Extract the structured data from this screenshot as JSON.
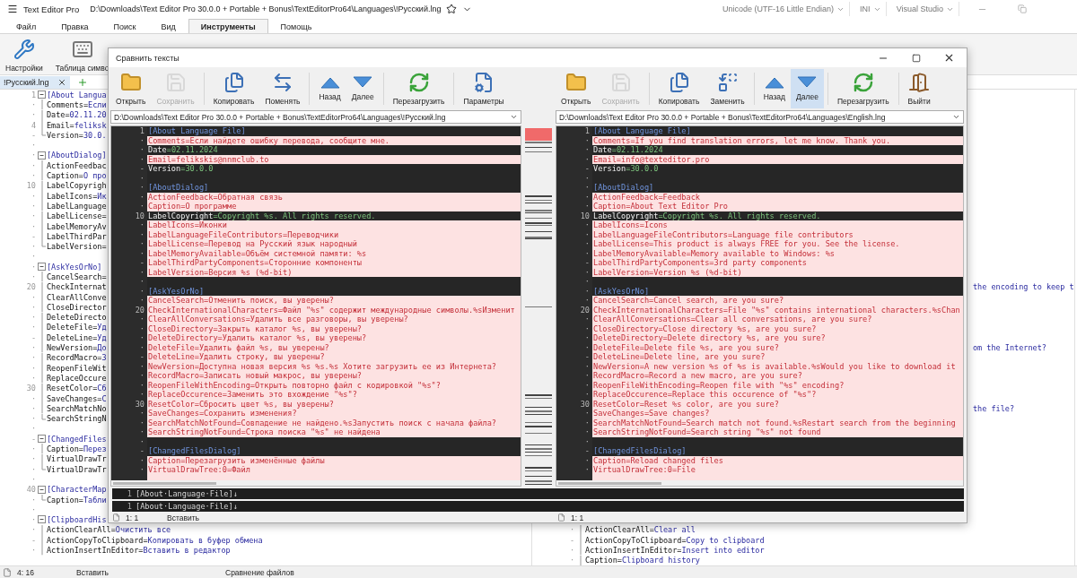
{
  "app": {
    "title": "Text Editor Pro",
    "path": "D:\\Downloads\\Text Editor Pro 30.0.0 + Portable + Bonus\\TextEditorPro64\\Languages\\!Русский.lng",
    "encoding": "Unicode (UTF-16 Little Endian)",
    "highlighter": "INI",
    "theme": "Visual Studio"
  },
  "menu_tabs": [
    {
      "label": "Файл",
      "selected": false
    },
    {
      "label": "Правка",
      "selected": false
    },
    {
      "label": "Поиск",
      "selected": false
    },
    {
      "label": "Вид",
      "selected": false
    },
    {
      "label": "Инструменты",
      "selected": true
    },
    {
      "label": "Помощь",
      "selected": false
    }
  ],
  "ribbon": [
    {
      "label": "Настройки",
      "kind": "settings"
    },
    {
      "label": "Таблица симво",
      "kind": "keyboard"
    }
  ],
  "document_tabs": [
    {
      "label": "!Русский.lng",
      "selected": true
    }
  ],
  "editor": {
    "left_lines": [
      {
        "gutter": "1",
        "kind": "section",
        "text": "[About Langua"
      },
      {
        "gutter": "·",
        "kind": "pair",
        "key": "Comments=",
        "value": "Если"
      },
      {
        "gutter": "·",
        "kind": "pair",
        "key": "Date=",
        "value": "02.11.20"
      },
      {
        "gutter": "4",
        "kind": "pair",
        "key": "Email=",
        "value": "feliksk"
      },
      {
        "gutter": "-",
        "kind": "pair",
        "key": "Version=",
        "value": "30.0."
      },
      {
        "gutter": "·",
        "kind": "empty"
      },
      {
        "gutter": "·",
        "kind": "section",
        "text": "[AboutDialog]"
      },
      {
        "gutter": "·",
        "kind": "pair",
        "key": "ActionFeedbac"
      },
      {
        "gutter": "·",
        "kind": "pair",
        "key": "Caption=",
        "value": "О про"
      },
      {
        "gutter": "10",
        "kind": "pair",
        "key": "LabelCopyrigh"
      },
      {
        "gutter": "·",
        "kind": "pair",
        "key": "LabelIcons=",
        "value": "Ик"
      },
      {
        "gutter": "·",
        "kind": "pair",
        "key": "LabelLanguage"
      },
      {
        "gutter": "·",
        "kind": "pair",
        "key": "LabelLicense="
      },
      {
        "gutter": "·",
        "kind": "pair",
        "key": "LabelMemoryAv"
      },
      {
        "gutter": "-",
        "kind": "pair",
        "key": "LabelThirdPar"
      },
      {
        "gutter": "·",
        "kind": "pair",
        "key": "LabelVersion="
      },
      {
        "gutter": "·",
        "kind": "empty"
      },
      {
        "gutter": "·",
        "kind": "section",
        "text": "[AskYesOrNo]"
      },
      {
        "gutter": "·",
        "kind": "pair",
        "key": "CancelSearch="
      },
      {
        "gutter": "20",
        "kind": "pair",
        "key": "CheckInternat"
      },
      {
        "gutter": "·",
        "kind": "pair",
        "key": "ClearAllConve"
      },
      {
        "gutter": "·",
        "kind": "pair",
        "key": "CloseDirector"
      },
      {
        "gutter": "·",
        "kind": "pair",
        "key": "DeleteDirecto"
      },
      {
        "gutter": "·",
        "kind": "pair",
        "key": "DeleteFile=",
        "value": "Уд"
      },
      {
        "gutter": "-",
        "kind": "pair",
        "key": "DeleteLine=",
        "value": "Уд"
      },
      {
        "gutter": "·",
        "kind": "pair",
        "key": "NewVersion=",
        "value": "До"
      },
      {
        "gutter": "·",
        "kind": "pair",
        "key": "RecordMacro=",
        "value": "З"
      },
      {
        "gutter": "·",
        "kind": "pair",
        "key": "ReopenFileWit"
      },
      {
        "gutter": "·",
        "kind": "pair",
        "key": "ReplaceOccure"
      },
      {
        "gutter": "30",
        "kind": "pair",
        "key": "ResetColor=",
        "value": "Сб"
      },
      {
        "gutter": "·",
        "kind": "pair",
        "key": "SaveChanges=",
        "value": "С"
      },
      {
        "gutter": "·",
        "kind": "pair",
        "key": "SearchMatchNo"
      },
      {
        "gutter": "·",
        "kind": "pair",
        "key": "SearchStringN"
      },
      {
        "gutter": "·",
        "kind": "empty"
      },
      {
        "gutter": "-",
        "kind": "section",
        "text": "[ChangedFiles"
      },
      {
        "gutter": "·",
        "kind": "pair",
        "key": "Caption=",
        "value": "Перез"
      },
      {
        "gutter": "·",
        "kind": "pair",
        "key": "VirtualDrawTr"
      },
      {
        "gutter": "·",
        "kind": "pair",
        "key": "VirtualDrawTr"
      },
      {
        "gutter": "·",
        "kind": "empty"
      },
      {
        "gutter": "40",
        "kind": "section",
        "text": "[CharacterMap"
      },
      {
        "gutter": "·",
        "kind": "pair",
        "key": "Caption=",
        "value": "Табли"
      },
      {
        "gutter": "·",
        "kind": "empty"
      },
      {
        "gutter": "·",
        "kind": "section",
        "text": "[ClipboardHis"
      },
      {
        "gutter": "·",
        "kind": "pair",
        "key": "ActionClearAll=",
        "value": "Очистить все"
      },
      {
        "gutter": "-",
        "kind": "pair",
        "key": "ActionCopyToClipboard=",
        "value": "Копировать в буфер обмена"
      },
      {
        "gutter": "·",
        "kind": "pair",
        "key": "ActionInsertInEditor=",
        "value": "Вставить в редактор"
      }
    ],
    "right_fragments": [
      {
        "text": "the encoding to keep t"
      },
      {
        "text": "om the Internet?"
      },
      {
        "text": "the file?"
      }
    ],
    "right_lines": [
      {
        "gutter": "·",
        "kind": "pair",
        "key": "ActionClearAll=",
        "value": "Clear all"
      },
      {
        "gutter": "-",
        "kind": "pair",
        "key": "ActionCopyToClipboard=",
        "value": "Copy to clipboard"
      },
      {
        "gutter": "·",
        "kind": "pair",
        "key": "ActionInsertInEditor=",
        "value": "Insert into editor"
      },
      {
        "gutter": "·",
        "kind": "pair",
        "key": "Caption=",
        "value": "Clipboard history"
      }
    ]
  },
  "status_bar": {
    "position": "4: 16",
    "mode": "Вставить",
    "message": "Сравнение файлов"
  },
  "dialog": {
    "title": "Сравнить тексты",
    "left": {
      "toolbar": [
        {
          "label": "Открыть",
          "kind": "open",
          "disabled": false,
          "active": false,
          "separator_after": false
        },
        {
          "label": "Сохранить",
          "kind": "save",
          "disabled": true,
          "active": false,
          "separator_after": true
        },
        {
          "label": "Копировать",
          "kind": "copy",
          "disabled": false,
          "active": false,
          "separator_after": false
        },
        {
          "label": "Поменять",
          "kind": "swap",
          "disabled": false,
          "active": false,
          "separator_after": true
        },
        {
          "label": "Назад",
          "kind": "up",
          "disabled": false,
          "active": false,
          "separator_after": false
        },
        {
          "label": "Далее",
          "kind": "down",
          "disabled": false,
          "active": false,
          "separator_after": true
        },
        {
          "label": "Перезагрузить",
          "kind": "reload",
          "disabled": false,
          "active": false,
          "separator_after": true
        },
        {
          "label": "Параметры",
          "kind": "params",
          "disabled": false,
          "active": false,
          "separator_after": false
        }
      ],
      "path": "D:\\Downloads\\Text Editor Pro 30.0.0 + Portable + Bonus\\TextEditorPro64\\Languages\\!Русский.lng",
      "lines": [
        {
          "gutter": "1",
          "kind": "section",
          "text": "[About Language File]"
        },
        {
          "gutter": "·",
          "kind": "changed",
          "text": "Comments=Если найдете ошибку перевода, сообщите мне."
        },
        {
          "gutter": "·",
          "kind": "same",
          "key": "Date",
          "value": "=02.11.2024"
        },
        {
          "gutter": "·",
          "kind": "changed",
          "text": "Email=felikskis@nnmclub.to"
        },
        {
          "gutter": "-",
          "kind": "same",
          "key": "Version",
          "value": "=30.0.0"
        },
        {
          "gutter": "·",
          "kind": "empty"
        },
        {
          "gutter": "·",
          "kind": "section",
          "text": "[AboutDialog]"
        },
        {
          "gutter": "·",
          "kind": "changed",
          "text": "ActionFeedback=Обратная связь"
        },
        {
          "gutter": "·",
          "kind": "changed",
          "text": "Caption=О программе"
        },
        {
          "gutter": "10",
          "kind": "same",
          "key": "LabelCopyright",
          "value": "=Copyright %s. All rights reserved."
        },
        {
          "gutter": "·",
          "kind": "changed",
          "text": "LabelIcons=Иконки"
        },
        {
          "gutter": "·",
          "kind": "changed",
          "text": "LabelLanguageFileContributors=Переводчики"
        },
        {
          "gutter": "·",
          "kind": "changed",
          "text": "LabelLicense=Перевод на Русский язык народный"
        },
        {
          "gutter": "·",
          "kind": "changed",
          "text": "LabelMemoryAvailable=Объём системной памяти: %s"
        },
        {
          "gutter": "-",
          "kind": "changed",
          "text": "LabelThirdPartyComponents=Сторонние компоненты"
        },
        {
          "gutter": "·",
          "kind": "changed",
          "text": "LabelVersion=Версия %s (%d-bit)"
        },
        {
          "gutter": "·",
          "kind": "empty"
        },
        {
          "gutter": "·",
          "kind": "section",
          "text": "[AskYesOrNo]"
        },
        {
          "gutter": "·",
          "kind": "changed",
          "text": "CancelSearch=Отменить поиск, вы уверены?"
        },
        {
          "gutter": "20",
          "kind": "changed",
          "text": "CheckInternationalCharacters=Файл \"%s\" содержит международные символы.%sИзменит"
        },
        {
          "gutter": "·",
          "kind": "changed",
          "text": "ClearAllConversations=Удалить все разговоры, вы уверены?"
        },
        {
          "gutter": "·",
          "kind": "changed",
          "text": "CloseDirectory=Закрыть каталог %s, вы уверены?"
        },
        {
          "gutter": "·",
          "kind": "changed",
          "text": "DeleteDirectory=Удалить каталог %s, вы уверены?"
        },
        {
          "gutter": "·",
          "kind": "changed",
          "text": "DeleteFile=Удалить файл %s, вы уверены?"
        },
        {
          "gutter": "-",
          "kind": "changed",
          "text": "DeleteLine=Удалить строку, вы уверены?"
        },
        {
          "gutter": "·",
          "kind": "changed",
          "text": "NewVersion=Доступна новая версия %s %s.%s Хотите загрузить ее из Интернета?"
        },
        {
          "gutter": "·",
          "kind": "changed",
          "text": "RecordMacro=Записать новый макрос, вы уверены?"
        },
        {
          "gutter": "·",
          "kind": "changed",
          "text": "ReopenFileWithEncoding=Открыть повторно файл с кодировкой \"%s\"?"
        },
        {
          "gutter": "·",
          "kind": "changed",
          "text": "ReplaceOccurence=Заменить это вхождение \"%s\"?"
        },
        {
          "gutter": "30",
          "kind": "changed",
          "text": "ResetColor=Сбросить цвет %s, вы уверены?"
        },
        {
          "gutter": "·",
          "kind": "changed",
          "text": "SaveChanges=Сохранить изменения?"
        },
        {
          "gutter": "·",
          "kind": "changed",
          "text": "SearchMatchNotFound=Совпадение не найдено.%sЗапустить поиск с начала файла?"
        },
        {
          "gutter": "·",
          "kind": "changed",
          "text": "SearchStringNotFound=Строка поиска \"%s\" не найдена"
        },
        {
          "gutter": "·",
          "kind": "empty"
        },
        {
          "gutter": "-",
          "kind": "section",
          "text": "[ChangedFilesDialog]"
        },
        {
          "gutter": "·",
          "kind": "changed",
          "text": "Caption=Перезагрузить изменённые файлы"
        },
        {
          "gutter": "·",
          "kind": "changed",
          "text": "VirtualDrawTree:0=Файл"
        }
      ],
      "current_line": {
        "gutter": "1",
        "text": "[About·Language·File]↓"
      },
      "status": {
        "position": "1: 1",
        "mode": "Вставить"
      }
    },
    "right": {
      "toolbar": [
        {
          "label": "Открыть",
          "kind": "open",
          "disabled": false,
          "active": false,
          "separator_after": false
        },
        {
          "label": "Сохранить",
          "kind": "save",
          "disabled": true,
          "active": false,
          "separator_after": true
        },
        {
          "label": "Копировать",
          "kind": "copy",
          "disabled": false,
          "active": false,
          "separator_after": false
        },
        {
          "label": "Заменить",
          "kind": "replace",
          "disabled": false,
          "active": false,
          "separator_after": true
        },
        {
          "label": "Назад",
          "kind": "up",
          "disabled": false,
          "active": false,
          "separator_after": false
        },
        {
          "label": "Далее",
          "kind": "down",
          "disabled": false,
          "active": true,
          "separator_after": true
        },
        {
          "label": "Перезагрузить",
          "kind": "reload",
          "disabled": false,
          "active": false,
          "separator_after": true
        },
        {
          "label": "Выйти",
          "kind": "exit",
          "disabled": false,
          "active": false,
          "separator_after": false
        }
      ],
      "path": "D:\\Downloads\\Text Editor Pro 30.0.0 + Portable + Bonus\\TextEditorPro64\\Languages\\English.lng",
      "lines": [
        {
          "gutter": "1",
          "kind": "section",
          "text": "[About Language File]"
        },
        {
          "gutter": "·",
          "kind": "changed",
          "text": "Comments=If you find translation errors, let me know. Thank you."
        },
        {
          "gutter": "·",
          "kind": "same",
          "key": "Date",
          "value": "=02.11.2024"
        },
        {
          "gutter": "·",
          "kind": "changed",
          "text": "Email=info@texteditor.pro"
        },
        {
          "gutter": "-",
          "kind": "same",
          "key": "Version",
          "value": "=30.0.0"
        },
        {
          "gutter": "·",
          "kind": "empty"
        },
        {
          "gutter": "·",
          "kind": "section",
          "text": "[AboutDialog]"
        },
        {
          "gutter": "·",
          "kind": "changed",
          "text": "ActionFeedback=Feedback"
        },
        {
          "gutter": "·",
          "kind": "changed",
          "text": "Caption=About Text Editor Pro"
        },
        {
          "gutter": "10",
          "kind": "same",
          "key": "LabelCopyright",
          "value": "=Copyright %s. All rights reserved."
        },
        {
          "gutter": "·",
          "kind": "changed",
          "text": "LabelIcons=Icons"
        },
        {
          "gutter": "·",
          "kind": "changed",
          "text": "LabelLanguageFileContributors=Language file contributors"
        },
        {
          "gutter": "·",
          "kind": "changed",
          "text": "LabelLicense=This product is always FREE for you. See the license."
        },
        {
          "gutter": "·",
          "kind": "changed",
          "text": "LabelMemoryAvailable=Memory available to Windows: %s"
        },
        {
          "gutter": "-",
          "kind": "changed",
          "text": "LabelThirdPartyComponents=3rd party components"
        },
        {
          "gutter": "·",
          "kind": "changed",
          "text": "LabelVersion=Version %s (%d-bit)"
        },
        {
          "gutter": "·",
          "kind": "empty"
        },
        {
          "gutter": "·",
          "kind": "section",
          "text": "[AskYesOrNo]"
        },
        {
          "gutter": "·",
          "kind": "changed",
          "text": "CancelSearch=Cancel search, are you sure?"
        },
        {
          "gutter": "20",
          "kind": "changed",
          "text": "CheckInternationalCharacters=File \"%s\" contains international characters.%sChan"
        },
        {
          "gutter": "·",
          "kind": "changed",
          "text": "ClearAllConversations=Clear all conversations, are you sure?"
        },
        {
          "gutter": "·",
          "kind": "changed",
          "text": "CloseDirectory=Close directory %s, are you sure?"
        },
        {
          "gutter": "·",
          "kind": "changed",
          "text": "DeleteDirectory=Delete directory %s, are you sure?"
        },
        {
          "gutter": "·",
          "kind": "changed",
          "text": "DeleteFile=Delete file %s, are you sure?"
        },
        {
          "gutter": "-",
          "kind": "changed",
          "text": "DeleteLine=Delete line, are you sure?"
        },
        {
          "gutter": "·",
          "kind": "changed",
          "text": "NewVersion=A new version %s of %s is available.%sWould you like to download it"
        },
        {
          "gutter": "·",
          "kind": "changed",
          "text": "RecordMacro=Record a new macro, are you sure?"
        },
        {
          "gutter": "·",
          "kind": "changed",
          "text": "ReopenFileWithEncoding=Reopen file with \"%s\" encoding?"
        },
        {
          "gutter": "·",
          "kind": "changed",
          "text": "ReplaceOccurence=Replace this occurence of \"%s\"?"
        },
        {
          "gutter": "30",
          "kind": "changed",
          "text": "ResetColor=Reset %s color, are you sure?"
        },
        {
          "gutter": "·",
          "kind": "changed",
          "text": "SaveChanges=Save changes?"
        },
        {
          "gutter": "·",
          "kind": "changed",
          "text": "SearchMatchNotFound=Search match not found.%sRestart search from the beginning"
        },
        {
          "gutter": "·",
          "kind": "changed",
          "text": "SearchStringNotFound=Search string \"%s\" not found"
        },
        {
          "gutter": "·",
          "kind": "empty"
        },
        {
          "gutter": "-",
          "kind": "section",
          "text": "[ChangedFilesDialog]"
        },
        {
          "gutter": "·",
          "kind": "changed",
          "text": "Caption=Reload changed files"
        },
        {
          "gutter": "·",
          "kind": "changed",
          "text": "VirtualDrawTree:0=File"
        }
      ],
      "current_line": {
        "gutter": "1",
        "text": "[About·Language·File]↓"
      },
      "status": {
        "position": "1: 1"
      }
    }
  }
}
